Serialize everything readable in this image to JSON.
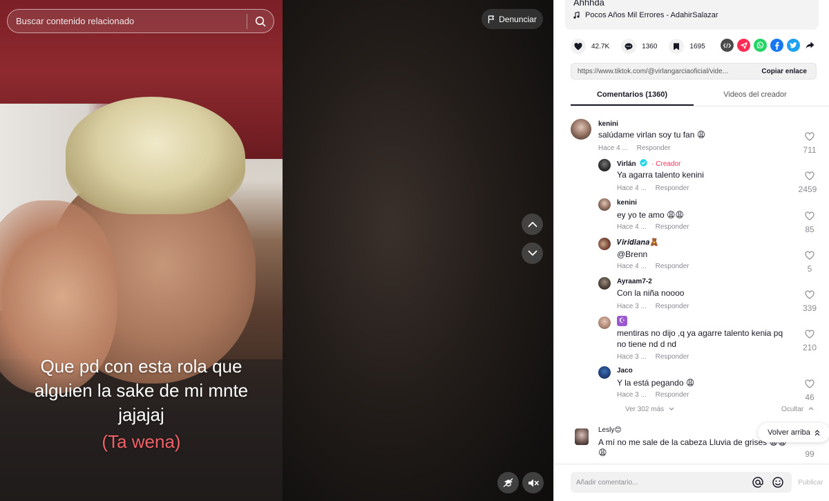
{
  "search": {
    "placeholder": "Buscar contenido relacionado"
  },
  "report": {
    "label": "Denunciar"
  },
  "caption": {
    "line1": "Que pd con esta rola que",
    "line2": "alguien la sake de mi mnte",
    "line3": "jajajaj",
    "line4": "(Ta wena)"
  },
  "video_info": {
    "description": "Ahhhda",
    "music": "Pocos Años Mil Errores - AdahirSalazar"
  },
  "stats": {
    "likes": "42.7K",
    "comments": "1360",
    "saves": "1695"
  },
  "share": {
    "icons": [
      "embed-icon",
      "tiktok-share-icon",
      "whatsapp-icon",
      "facebook-icon",
      "twitter-icon",
      "forward-icon"
    ],
    "colors": {
      "embed": "#4a4a4a",
      "tiktok": "#fe2c55",
      "whatsapp": "#25d366",
      "facebook": "#1877f2",
      "twitter": "#1da1f2"
    }
  },
  "link": {
    "url": "https://www.tiktok.com/@virlangarciaoficial/vide...",
    "copy_label": "Copiar enlace"
  },
  "tabs": [
    {
      "label": "Comentarios (1360)",
      "active": true
    },
    {
      "label": "Videos del creador",
      "active": false
    }
  ],
  "comments": [
    {
      "user": "kenini",
      "text": "salúdame virlan soy tu fan 😩",
      "time": "Hace 4 ...",
      "reply": "Responder",
      "likes": "711"
    },
    {
      "user": "Virlán",
      "badge": "Creador",
      "text": "Ya agarra talento kenini",
      "time": "Hace 4 ...",
      "reply": "Responder",
      "likes": "2459"
    },
    {
      "user": "kenini",
      "text": "ey yo te amo 😩😩",
      "time": "Hace 4 ...",
      "reply": "Responder",
      "likes": "85"
    },
    {
      "user": "𝑽𝒊𝒓𝒊𝒅𝒊𝒂𝒏𝒂🧸",
      "text": "@Brenn",
      "time": "Hace 4 ...",
      "reply": "Responder",
      "likes": "5"
    },
    {
      "user": "Ayraam7-2",
      "text": "Con la niña noooo",
      "time": "Hace 3 ...",
      "reply": "Responder",
      "likes": "339"
    },
    {
      "user": "☪",
      "text": "mentiras no dijo ,q ya agarre talento kenia pq",
      "text2": "no tiene nd d nd",
      "time": "Hace 3 ...",
      "reply": "Responder",
      "likes": "210"
    },
    {
      "user": "Jaco",
      "text": "Y la está pegando 😩",
      "time": "Hace 3 ...",
      "reply": "Responder",
      "likes": "46"
    },
    {
      "user": "Lesly😊",
      "text": "A mí no me sale de la cabeza Lluvia de grises 😩😩",
      "text2": "😩",
      "likes": "99"
    }
  ],
  "more_replies": "Ver 302 más",
  "hide_label": "Ocultar",
  "back_to_top": "Volver arriba",
  "footer": {
    "placeholder": "Añadir comentario...",
    "publish": "Publicar"
  }
}
